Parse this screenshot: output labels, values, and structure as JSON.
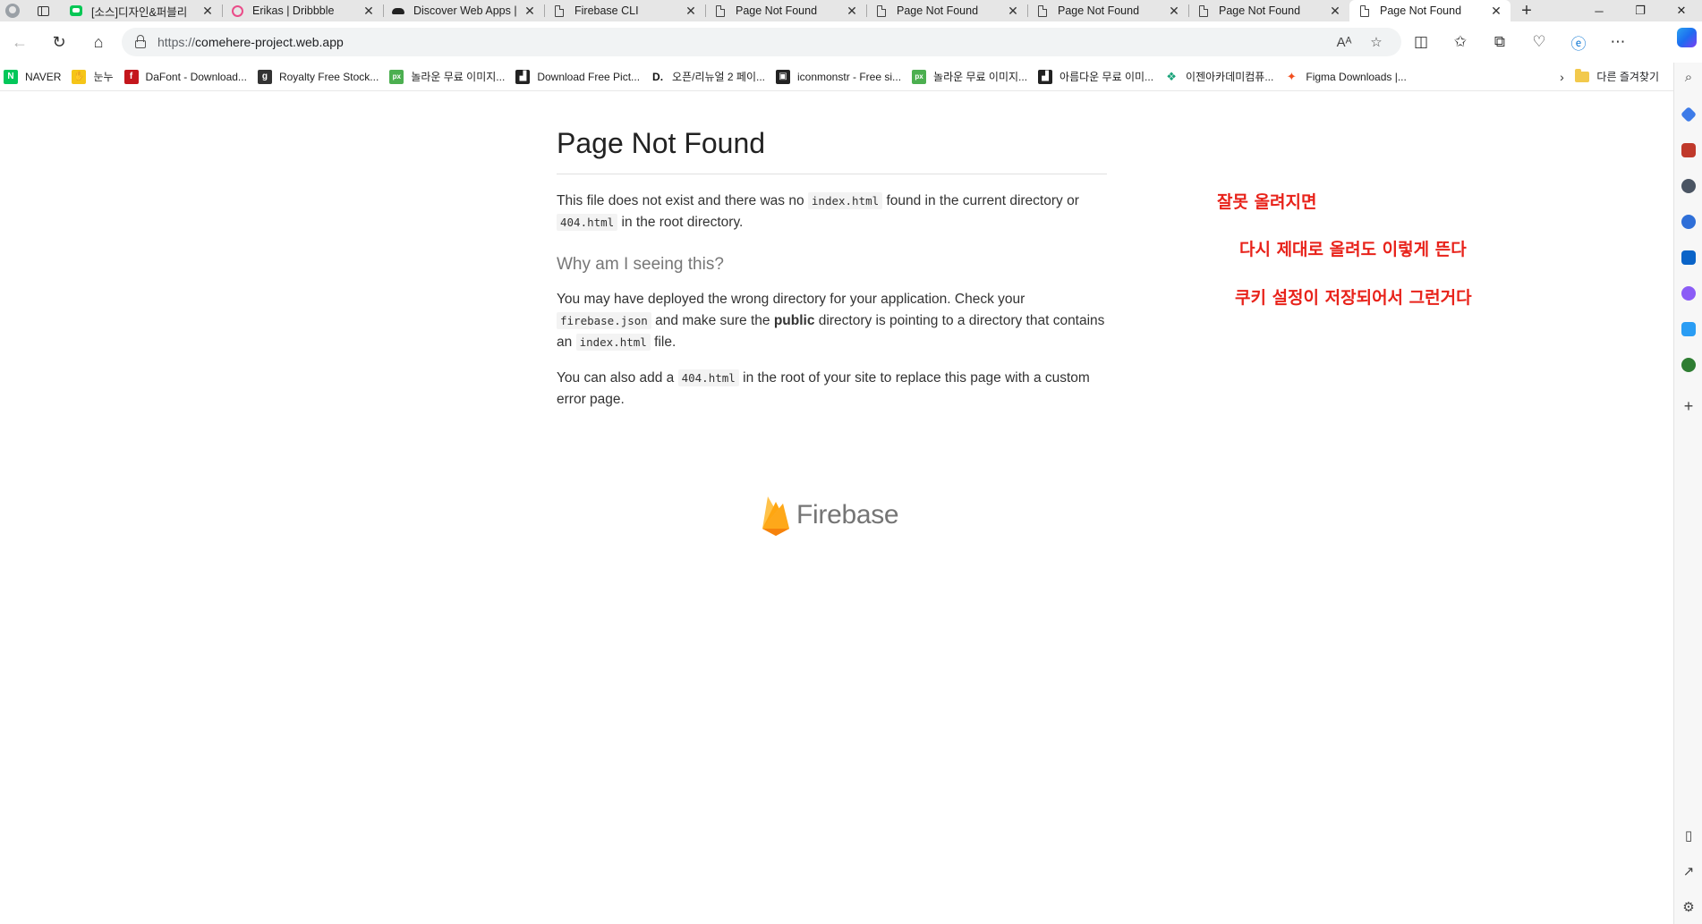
{
  "browser": {
    "tabs": [
      {
        "title": "[소스]디자인&퍼블리",
        "favicon": "line-icon"
      },
      {
        "title": "Erikas | Dribbble",
        "favicon": "dribbble-icon"
      },
      {
        "title": "Discover Web Apps | ",
        "favicon": "mustache-icon"
      },
      {
        "title": "Firebase CLI",
        "favicon": "page-icon"
      },
      {
        "title": "Page Not Found",
        "favicon": "page-icon"
      },
      {
        "title": "Page Not Found",
        "favicon": "page-icon"
      },
      {
        "title": "Page Not Found",
        "favicon": "page-icon"
      },
      {
        "title": "Page Not Found",
        "favicon": "page-icon"
      },
      {
        "title": "Page Not Found",
        "favicon": "page-icon",
        "active": true
      }
    ],
    "address": {
      "protocol": "https://",
      "host": "comehere-project.web.app"
    },
    "bookmarks": [
      {
        "label": "NAVER",
        "icon_color": "#03c75a",
        "glyph": "N"
      },
      {
        "label": "눈누",
        "icon_color": "#f5c518",
        "glyph": "✋"
      },
      {
        "label": "DaFont - Download...",
        "icon_color": "#c4161c",
        "glyph": "f"
      },
      {
        "label": "Royalty Free Stock...",
        "icon_color": "#333333",
        "glyph": "g"
      },
      {
        "label": "놀라운 무료 이미지...",
        "icon_color": "#4caf50",
        "glyph": "px"
      },
      {
        "label": "Download Free Pict...",
        "icon_color": "#222222",
        "glyph": "▟"
      },
      {
        "label": "오픈/리뉴얼 2 페이...",
        "icon_color": "#ffffff",
        "glyph": "D."
      },
      {
        "label": "iconmonstr - Free si...",
        "icon_color": "#222222",
        "glyph": "▣"
      },
      {
        "label": "놀라운 무료 이미지...",
        "icon_color": "#4caf50",
        "glyph": "px"
      },
      {
        "label": "아름다운 무료 이미...",
        "icon_color": "#222222",
        "glyph": "▟"
      },
      {
        "label": "이젠아카데미컴퓨...",
        "icon_color": "#ffffff",
        "glyph": "❖"
      },
      {
        "label": "Figma Downloads |...",
        "icon_color": "#f24e1e",
        "glyph": "✦"
      }
    ],
    "other_favorites": "다른 즐겨찾기"
  },
  "page": {
    "title": "Page Not Found",
    "p1": {
      "t1": "This file does not exist and there was no ",
      "c1": "index.html",
      "t2": " found in the current directory or ",
      "c2": "404.html",
      "t3": " in the root directory."
    },
    "subtitle": "Why am I seeing this?",
    "p2": {
      "t1": "You may have deployed the wrong directory for your application. Check your ",
      "c1": "firebase.json",
      "t2": " and make sure the ",
      "b1": "public",
      "t3": " directory is pointing to a directory that contains an ",
      "c2": "index.html",
      "t4": " file."
    },
    "p3": {
      "t1": "You can also add a ",
      "c1": "404.html",
      "t2": " in the root of your site to replace this page with a custom error page."
    },
    "logo_text": "Firebase"
  },
  "annotations": [
    "잘못 올려지면",
    "다시 제대로 올려도 이렇게 뜬다",
    "쿠키 설정이 저장되어서 그런거다"
  ],
  "colors": {
    "annotation": "#e8221a",
    "firebase_yellow": "#ffca28",
    "firebase_orange": "#ffa000",
    "firebase_amber": "#f57c00"
  }
}
